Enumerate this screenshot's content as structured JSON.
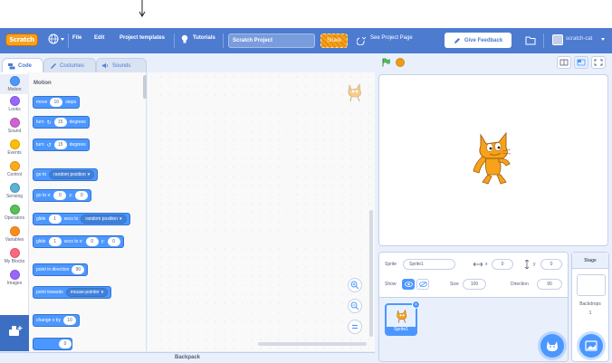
{
  "menubar": {
    "logo": "Scratch",
    "file": "File",
    "edit": "Edit",
    "project_templates": "Project templates",
    "tutorials": "Tutorials",
    "project_title": "Scratch Project",
    "share": "Share",
    "see_project_page": "See Project Page",
    "give_feedback": "Give Feedback",
    "username": "scratch-cat"
  },
  "tabs": [
    {
      "label": "Code",
      "icon": "code-icon"
    },
    {
      "label": "Costumes",
      "icon": "brush-icon"
    },
    {
      "label": "Sounds",
      "icon": "speaker-icon"
    }
  ],
  "categories": [
    {
      "label": "Motion",
      "color": "#4c97ff"
    },
    {
      "label": "Looks",
      "color": "#9966ff"
    },
    {
      "label": "Sound",
      "color": "#cf63cf"
    },
    {
      "label": "Events",
      "color": "#ffbf00"
    },
    {
      "label": "Control",
      "color": "#ffab19"
    },
    {
      "label": "Sensing",
      "color": "#5cb1d6"
    },
    {
      "label": "Operators",
      "color": "#59c059"
    },
    {
      "label": "Variables",
      "color": "#ff8c1a"
    },
    {
      "label": "My Blocks",
      "color": "#ff6680"
    },
    {
      "label": "Images",
      "color": "#9966ff"
    }
  ],
  "palette": {
    "title": "Motion",
    "blocks": {
      "move_a": "move",
      "move_n": "10",
      "move_b": "steps",
      "turn_r_a": "turn",
      "turn_r_n": "15",
      "turn_r_b": "degrees",
      "turn_l_a": "turn",
      "turn_l_n": "15",
      "turn_l_b": "degrees",
      "goto_a": "go to",
      "goto_dd": "random position",
      "gotoxy_a": "go to x:",
      "gotoxy_x": "0",
      "gotoxy_b": "y:",
      "gotoxy_y": "0",
      "glide_a": "glide",
      "glide_n": "1",
      "glide_b": "secs to",
      "glide_dd": "random position",
      "glidexy_a": "glide",
      "glidexy_n": "1",
      "glidexy_b": "secs to x:",
      "glidexy_x": "0",
      "glidexy_c": "y:",
      "glidexy_y": "0",
      "point_a": "point in direction",
      "point_n": "90",
      "towards_a": "point towards",
      "towards_dd": "mouse-pointer",
      "changex_a": "change x by",
      "changex_n": "10",
      "setx_n": "0"
    }
  },
  "sprite_info": {
    "sprite_label": "Sprite",
    "sprite_name": "Sprite1",
    "x_label": "x",
    "x_value": "0",
    "y_label": "y",
    "y_value": "0",
    "show_label": "Show",
    "size_label": "Size",
    "size_value": "100",
    "direction_label": "Direction",
    "direction_value": "90"
  },
  "sprite_list": [
    {
      "name": "Sprite1"
    }
  ],
  "stage_pane": {
    "title": "Stage",
    "backdrops_label": "Backdrops",
    "backdrops_count": "1"
  },
  "backpack": "Backpack",
  "colors": {
    "menubar": "#4c7bd0",
    "motion": "#4c97ff",
    "accent_orange": "#f7a21b"
  }
}
